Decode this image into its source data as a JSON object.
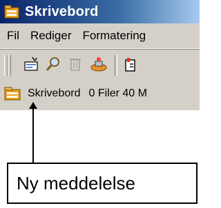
{
  "window": {
    "title": "Skrivebord",
    "title_icon": "folder-desktop-icon"
  },
  "menubar": {
    "items": [
      "Fil",
      "Rediger",
      "Formatering"
    ]
  },
  "toolbar": {
    "buttons": [
      {
        "name": "new-message-icon"
      },
      {
        "name": "search-icon"
      },
      {
        "name": "delete-icon"
      },
      {
        "name": "address-book-icon"
      },
      {
        "name": "send-receive-icon"
      }
    ]
  },
  "statusbar": {
    "icon": "folder-desktop-icon",
    "location": "Skrivebord",
    "info": "0 Filer 40 M"
  },
  "callout": {
    "label": "Ny meddelelse"
  },
  "colors": {
    "titlebar_start": "#0a246a",
    "titlebar_end": "#a6caf0",
    "chrome": "#d4d0c8"
  }
}
